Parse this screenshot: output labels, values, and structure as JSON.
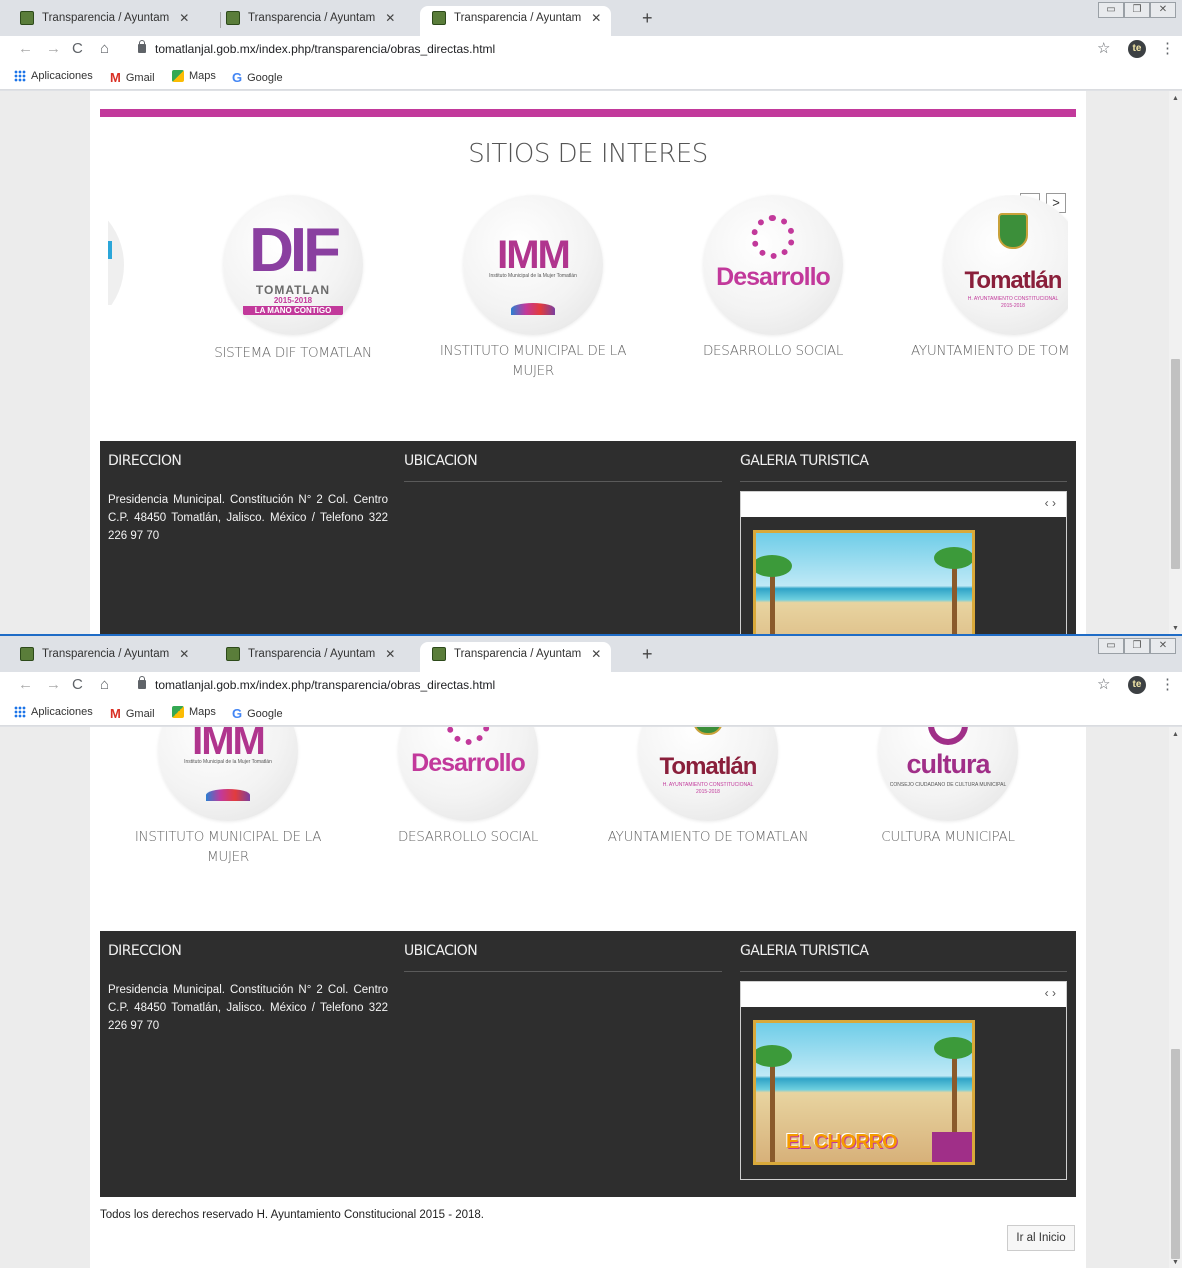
{
  "browser": {
    "tabs": [
      {
        "title": "Transparencia / Ayuntamiento de",
        "close": "✕"
      },
      {
        "title": "Transparencia / Ayuntamiento de",
        "close": "✕"
      },
      {
        "title": "Transparencia / Ayuntamiento de",
        "close": "✕"
      }
    ],
    "new_tab": "+",
    "url": "tomatlanjal.gob.mx/index.php/transparencia/obras_directas.html",
    "profile_initials": "te",
    "bookmarks": [
      {
        "label": "Aplicaciones",
        "icon": "apps-icon"
      },
      {
        "label": "Gmail",
        "icon": "gmail-icon"
      },
      {
        "label": "Maps",
        "icon": "maps-icon"
      },
      {
        "label": "Google",
        "icon": "google-icon"
      }
    ]
  },
  "sitios": {
    "title": "SITIOS DE INTERES",
    "prev": "<",
    "next": ">",
    "items": [
      {
        "caption": "SISTEMA DIF TOMATLAN",
        "logo": "DIF",
        "logo_sub": "TOMATLAN",
        "logo_band": "LA MANO CONTIGO",
        "logo_years": "2015-2018"
      },
      {
        "caption": "INSTITUTO MUNICIPAL DE LA MUJER",
        "logo": "IMM",
        "logo_sub": "Instituto Municipal de la Mujer Tomatlán"
      },
      {
        "caption": "DESARROLLO SOCIAL",
        "logo": "Desarrollo"
      },
      {
        "caption": "AYUNTAMIENTO DE TOMATLAN",
        "caption_clipped": "AYUNTAMIENTO DE TOM",
        "logo": "Tomatlán",
        "logo_sub": "H. AYUNTAMIENTO CONSTITUCIONAL",
        "logo_years": "2015-2018"
      },
      {
        "caption": "CULTURA MUNICIPAL",
        "logo": "cultura",
        "logo_sub": "CONSEJO CIUDADANO DE CULTURA MUNICIPAL"
      }
    ]
  },
  "footer": {
    "direccion_title": "DIRECCION",
    "ubicacion_title": "UBICACION",
    "galeria_title": "GALERIA TURISTICA",
    "address": "Presidencia Municipal. Constitución N° 2 Col. Centro C.P. 48450 Tomatlán, Jalisco. México / Telefono 322 226 97 70",
    "gallery_nav": "‹ ›",
    "gallery_image_title": "EL CHORRO",
    "copyright": "Todos los derechos reservado H. Ayuntamiento Constitucional 2015 - 2018.",
    "back_to_top": "Ir al Inicio"
  },
  "colors": {
    "accent_pink": "#c2399b",
    "footer_bg": "#2e2e2e"
  }
}
